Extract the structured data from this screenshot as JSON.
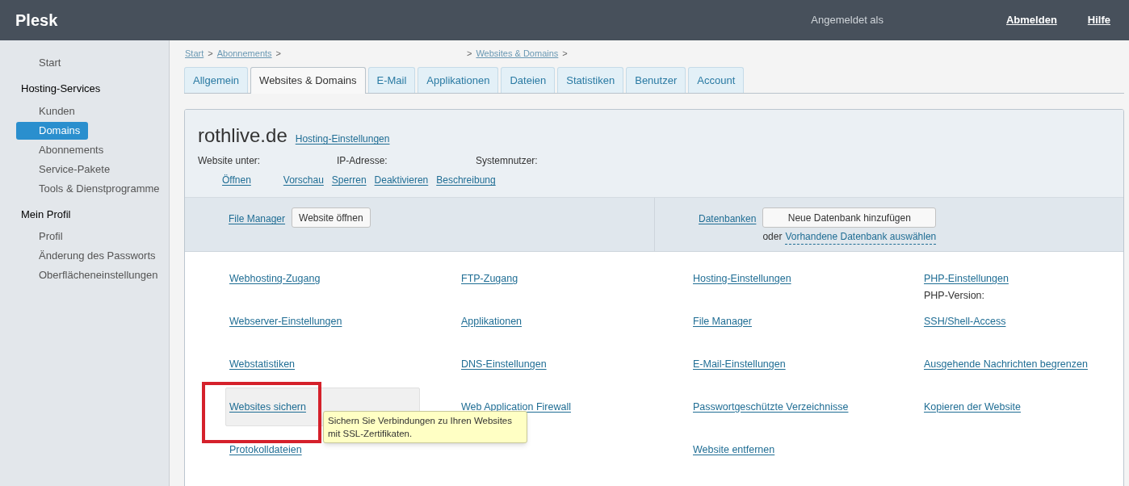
{
  "header": {
    "logo": "Plesk",
    "logged_in_label": "Angemeldet als",
    "links": [
      "Abmelden",
      "Hilfe"
    ]
  },
  "sidebar": {
    "groups": [
      {
        "items": [
          {
            "label": "Start",
            "selected": false
          }
        ]
      },
      {
        "title": "Hosting-Services",
        "items": [
          {
            "label": "Kunden",
            "selected": false
          },
          {
            "label": "Domains",
            "selected": true
          },
          {
            "label": "Abonnements",
            "selected": false
          },
          {
            "label": "Service-Pakete",
            "selected": false
          },
          {
            "label": "Tools & Dienstprogramme",
            "selected": false
          }
        ]
      },
      {
        "title": "Mein Profil",
        "items": [
          {
            "label": "Profil",
            "selected": false
          },
          {
            "label": "Änderung des Passworts",
            "selected": false
          },
          {
            "label": "Oberflächeneinstellungen",
            "selected": false
          }
        ]
      }
    ]
  },
  "breadcrumbs": [
    {
      "kind": "link",
      "label": "Start"
    },
    {
      "kind": "separator",
      "label": ">"
    },
    {
      "kind": "link",
      "label": "Abonnements"
    },
    {
      "kind": "separator",
      "label": ">"
    },
    {
      "kind": "redacted"
    },
    {
      "kind": "separator",
      "label": ">"
    },
    {
      "kind": "link",
      "label": "Websites & Domains"
    },
    {
      "kind": "separator",
      "label": ">"
    }
  ],
  "tabs": [
    {
      "label": "Allgemein",
      "selected": false
    },
    {
      "label": "Websites & Domains",
      "selected": true
    },
    {
      "label": "E-Mail",
      "selected": false
    },
    {
      "label": "Applikationen",
      "selected": false
    },
    {
      "label": "Dateien",
      "selected": false
    },
    {
      "label": "Statistiken",
      "selected": false
    },
    {
      "label": "Benutzer",
      "selected": false
    },
    {
      "label": "Account",
      "selected": false
    }
  ],
  "domain": {
    "name": "rothlive.de",
    "settings_link": "Hosting-Einstellungen",
    "fields": [
      {
        "label": "Website unter:"
      },
      {
        "label": "IP-Adresse:"
      },
      {
        "label": "Systemnutzer:"
      }
    ],
    "actions": [
      {
        "kind": "redacted"
      },
      {
        "kind": "link",
        "label": "Öffnen"
      },
      {
        "kind": "redacted"
      },
      {
        "kind": "link",
        "label": "Vorschau"
      },
      {
        "kind": "link",
        "label": "Sperren"
      },
      {
        "kind": "link",
        "label": "Deaktivieren"
      },
      {
        "kind": "link",
        "label": "Beschreibung"
      }
    ]
  },
  "quick": {
    "file_manager_link": "File Manager",
    "open_button": "Website öffnen",
    "databases_link": "Datenbanken",
    "add_db_button": "Neue Datenbank hinzufügen",
    "or_label": "oder",
    "select_db_link": "Vorhandene Datenbank auswählen"
  },
  "link_columns": [
    [
      {
        "label": "Webhosting-Zugang"
      },
      {
        "label": "Webserver-Einstellungen"
      },
      {
        "label": "Webstatistiken"
      },
      {
        "label": "Websites sichern",
        "highlighted": true,
        "tooltip": "Sichern Sie Verbindungen zu Ihren Websites mit SSL-Zertifikaten."
      },
      {
        "label": "Protokolldateien"
      }
    ],
    [
      {
        "label": "FTP-Zugang"
      },
      {
        "label": "Applikationen"
      },
      {
        "label": "DNS-Einstellungen"
      },
      {
        "label": "Web Application Firewall"
      }
    ],
    [
      {
        "label": "Hosting-Einstellungen"
      },
      {
        "label": "File Manager"
      },
      {
        "label": "E-Mail-Einstellungen"
      },
      {
        "label": "Passwortgeschützte Verzeichnisse"
      },
      {
        "label": "Website entfernen"
      }
    ],
    [
      {
        "label": "PHP-Einstellungen",
        "note": "PHP-Version:"
      },
      {
        "label": "SSH/Shell-Access"
      },
      {
        "label": "Ausgehende Nachrichten begrenzen"
      },
      {
        "label": "Kopieren der Website"
      }
    ]
  ]
}
